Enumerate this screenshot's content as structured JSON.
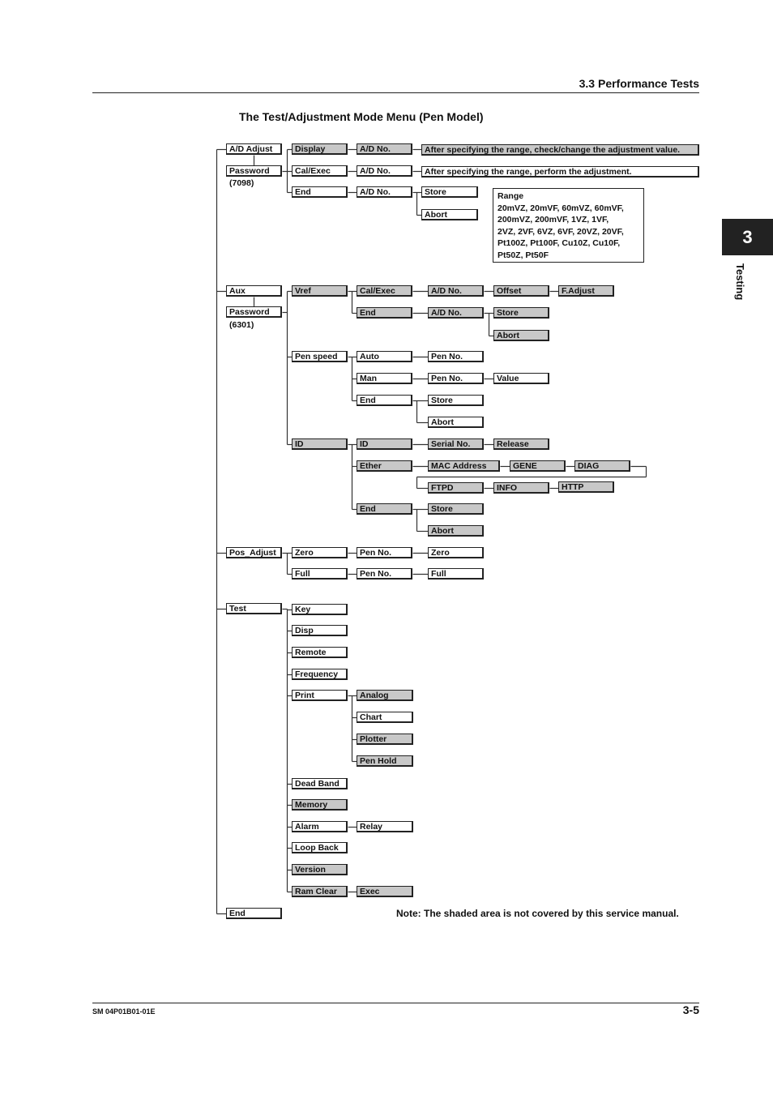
{
  "header": {
    "section": "3.3  Performance Tests"
  },
  "diagram_title": "The Test/Adjustment Mode Menu (Pen Model)",
  "chapter_tab": {
    "number": "3",
    "label": "Testing"
  },
  "footer": {
    "doc_id": "SM 04P01B01-01E",
    "page": "3-5"
  },
  "footnote": "Note: The shaded area is not covered by this service manual.",
  "range_box": {
    "title": "Range",
    "lines": [
      "20mVZ, 20mVF, 60mVZ, 60mVF,",
      "200mVZ, 200mVF, 1VZ, 1VF,",
      "2VZ, 2VF, 6VZ, 6VF, 20VZ, 20VF,",
      "Pt100Z, Pt100F, Cu10Z, Cu10F,",
      "Pt50Z, Pt50F"
    ]
  },
  "notes": {
    "ad_password": "(7098)",
    "aux_password": "(6301)"
  },
  "nodes": {
    "ad_adjust": {
      "label": "A/D Adjust",
      "shaded": false
    },
    "ad_password": {
      "label": "Password",
      "shaded": false
    },
    "display": {
      "label": "Display",
      "shaded": true
    },
    "display_adno": {
      "label": "A/D No.",
      "shaded": true
    },
    "display_desc": {
      "label": "After specifying the range, check/change the adjustment value.",
      "shaded": true
    },
    "calexec": {
      "label": "Cal/Exec",
      "shaded": false
    },
    "calexec_adno": {
      "label": "A/D No.",
      "shaded": false
    },
    "calexec_desc": {
      "label": "After specifying the range, perform the adjustment.",
      "shaded": false
    },
    "ad_end": {
      "label": "End",
      "shaded": false
    },
    "ad_end_adno": {
      "label": "A/D No.",
      "shaded": false
    },
    "ad_store": {
      "label": "Store",
      "shaded": false
    },
    "ad_abort": {
      "label": "Abort",
      "shaded": false
    },
    "aux": {
      "label": "Aux",
      "shaded": false
    },
    "aux_password": {
      "label": "Password",
      "shaded": false
    },
    "vref": {
      "label": "Vref",
      "shaded": true
    },
    "vref_calexec": {
      "label": "Cal/Exec",
      "shaded": true
    },
    "vref_calexec_adno": {
      "label": "A/D No.",
      "shaded": true
    },
    "vref_offset": {
      "label": "Offset",
      "shaded": true
    },
    "vref_fadjust": {
      "label": "F.Adjust",
      "shaded": true
    },
    "vref_end": {
      "label": "End",
      "shaded": true
    },
    "vref_end_adno": {
      "label": "A/D No.",
      "shaded": true
    },
    "vref_store": {
      "label": "Store",
      "shaded": true
    },
    "vref_abort": {
      "label": "Abort",
      "shaded": true
    },
    "penspeed": {
      "label": "Pen speed",
      "shaded": false
    },
    "ps_auto": {
      "label": "Auto",
      "shaded": false
    },
    "ps_auto_penno": {
      "label": "Pen No.",
      "shaded": false
    },
    "ps_man": {
      "label": "Man",
      "shaded": false
    },
    "ps_man_penno": {
      "label": "Pen No.",
      "shaded": false
    },
    "ps_value": {
      "label": "Value",
      "shaded": false
    },
    "ps_end": {
      "label": "End",
      "shaded": false
    },
    "ps_store": {
      "label": "Store",
      "shaded": false
    },
    "ps_abort": {
      "label": "Abort",
      "shaded": false
    },
    "id": {
      "label": "ID",
      "shaded": true
    },
    "id_id": {
      "label": "ID",
      "shaded": true
    },
    "id_serial": {
      "label": "Serial No.",
      "shaded": true
    },
    "id_release": {
      "label": "Release",
      "shaded": true
    },
    "id_ether": {
      "label": "Ether",
      "shaded": true
    },
    "id_mac": {
      "label": "MAC Address",
      "shaded": true
    },
    "id_gene": {
      "label": "GENE",
      "shaded": true
    },
    "id_diag": {
      "label": "DIAG",
      "shaded": true
    },
    "id_ftpd": {
      "label": "FTPD",
      "shaded": true
    },
    "id_info": {
      "label": "INFO",
      "shaded": true
    },
    "id_http": {
      "label": "HTTP",
      "shaded": true
    },
    "id_end": {
      "label": "End",
      "shaded": true
    },
    "id_store": {
      "label": "Store",
      "shaded": true
    },
    "id_abort": {
      "label": "Abort",
      "shaded": true
    },
    "pos_adjust": {
      "label": "Pos_Adjust",
      "shaded": false
    },
    "pos_zero": {
      "label": "Zero",
      "shaded": false
    },
    "pos_zero_penno": {
      "label": "Pen No.",
      "shaded": false
    },
    "pos_zero_zero": {
      "label": "Zero",
      "shaded": false
    },
    "pos_full": {
      "label": "Full",
      "shaded": false
    },
    "pos_full_penno": {
      "label": "Pen No.",
      "shaded": false
    },
    "pos_full_full": {
      "label": "Full",
      "shaded": false
    },
    "test": {
      "label": "Test",
      "shaded": false
    },
    "t_key": {
      "label": "Key",
      "shaded": false
    },
    "t_disp": {
      "label": "Disp",
      "shaded": false
    },
    "t_remote": {
      "label": "Remote",
      "shaded": false
    },
    "t_frequency": {
      "label": "Frequency",
      "shaded": false
    },
    "t_print": {
      "label": "Print",
      "shaded": false
    },
    "t_analog": {
      "label": "Analog",
      "shaded": true
    },
    "t_chart": {
      "label": "Chart",
      "shaded": false
    },
    "t_plotter": {
      "label": "Plotter",
      "shaded": true
    },
    "t_penhold": {
      "label": "Pen Hold",
      "shaded": true
    },
    "t_deadband": {
      "label": "Dead Band",
      "shaded": false
    },
    "t_memory": {
      "label": "Memory",
      "shaded": true
    },
    "t_alarm": {
      "label": "Alarm",
      "shaded": false
    },
    "t_relay": {
      "label": "Relay",
      "shaded": false
    },
    "t_loopback": {
      "label": "Loop Back",
      "shaded": false
    },
    "t_version": {
      "label": "Version",
      "shaded": true
    },
    "t_ramclear": {
      "label": "Ram Clear",
      "shaded": true
    },
    "t_exec": {
      "label": "Exec",
      "shaded": true
    },
    "root_end": {
      "label": "End",
      "shaded": false
    }
  }
}
